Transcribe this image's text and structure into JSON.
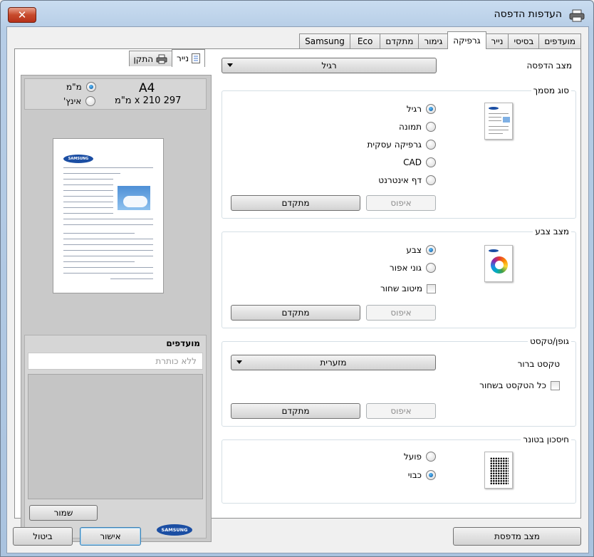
{
  "window": {
    "title": "העדפות הדפסה",
    "close_label": "✕"
  },
  "tabs": [
    "מועדפים",
    "בסיסי",
    "נייר",
    "גרפיקה",
    "גימור",
    "מתקדם",
    "Eco",
    "Samsung"
  ],
  "active_tab": "גרפיקה",
  "left_panel": {
    "tabs": [
      "נייר",
      "התקן"
    ],
    "paper_size": "A4",
    "paper_dims": "297 x 210 מ\"מ",
    "units": [
      "מ\"מ",
      "אינץ'"
    ],
    "units_selected": "מ\"מ",
    "preview_logo": "SAMSUNG",
    "favorites_title": "מועדפים",
    "favorites_placeholder": "ללא כותרת",
    "save_label": "שמור",
    "brand_logo": "SAMSUNG"
  },
  "print_mode": {
    "label": "מצב הדפסה",
    "value": "רגיל"
  },
  "document_type": {
    "title": "סוג מסמך",
    "options": [
      "רגיל",
      "תמונה",
      "גרפיקה עסקית",
      "CAD",
      "דף אינטרנט"
    ],
    "selected": "רגיל",
    "reset_label": "איפוס",
    "advanced_label": "מתקדם"
  },
  "color_mode": {
    "title": "מצב צבע",
    "options": [
      "צבע",
      "גוני אפור"
    ],
    "selected": "צבע",
    "checkbox_label": "מיטוב שחור",
    "checkbox_checked": false,
    "reset_label": "איפוס",
    "advanced_label": "מתקדם"
  },
  "font_text": {
    "title": "גופן/טקסט",
    "clear_text_label": "טקסט ברור",
    "clear_text_value": "מזערית",
    "all_black_label": "כל הטקסט בשחור",
    "all_black_checked": false,
    "reset_label": "איפוס",
    "advanced_label": "מתקדם"
  },
  "toner_save": {
    "title": "חיסכון בטונר",
    "options": [
      "פועל",
      "כבוי"
    ],
    "selected": "כבוי"
  },
  "footer": {
    "printer_status": "מצב מדפסת",
    "ok": "אישור",
    "cancel": "ביטול"
  },
  "colors": {
    "accent": "#1b4ea3",
    "title_bar": "#b6cde6",
    "close_red": "#c74a2c"
  }
}
